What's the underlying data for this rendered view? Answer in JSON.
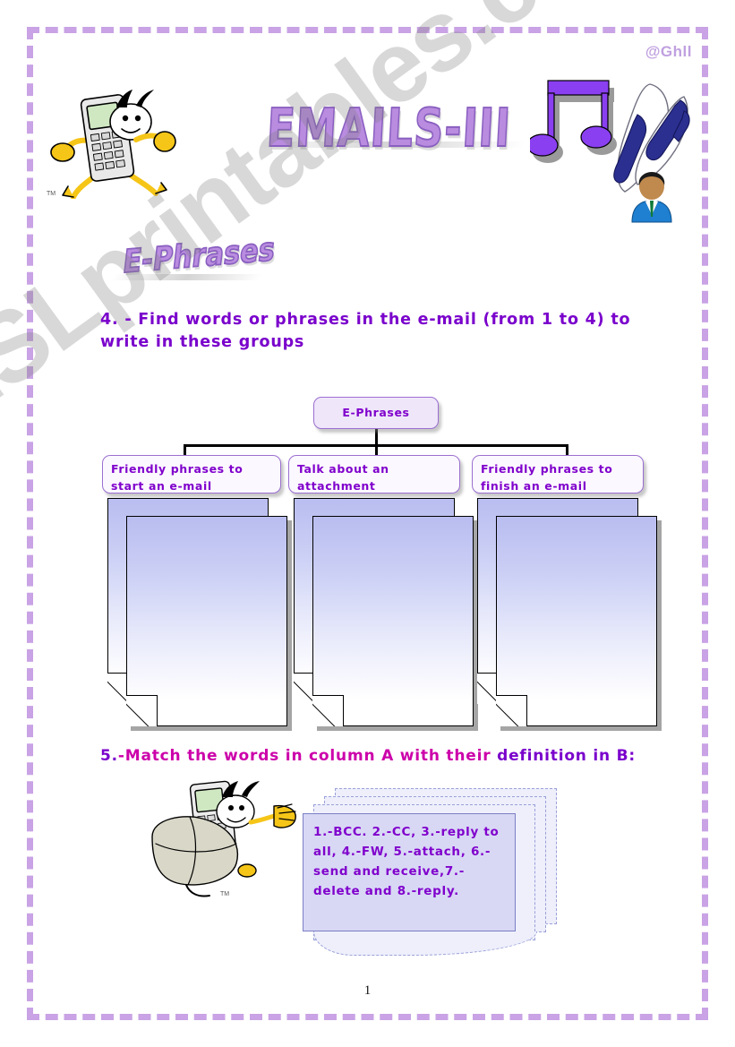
{
  "meta": {
    "credit": "@Ghll",
    "page_number": "1",
    "watermark": "ESLprintables.com"
  },
  "titles": {
    "main": "EMAILS-III",
    "section": "E-Phrases"
  },
  "exercises": [
    {
      "number": "4. - ",
      "text": "Find words or phrases in the e-mail (from 1 to 4) to write in these groups"
    },
    {
      "number": "5.",
      "text_magenta": "-Match the words in column A with their ",
      "text_purple": "definition in B:"
    }
  ],
  "diagram": {
    "root": "E-Phrases",
    "branches": [
      "Friendly phrases to start an e-mail",
      "Talk about an attachment",
      "Friendly phrases to finish an e-mail"
    ]
  },
  "answer_areas": [
    {
      "label": "blank-paper-stack-1"
    },
    {
      "label": "blank-paper-stack-2"
    },
    {
      "label": "blank-paper-stack-3"
    }
  ],
  "word_list": {
    "text": "1.-BCC. 2.-CC, 3.-reply to all, 4.-FW, 5.-attach, 6.- send and receive,7.- delete and  8.-reply."
  },
  "clipart": {
    "phone_mascot": "cellphone-mascot-icon",
    "music_notes": "music-notes-icon",
    "pens": "pens-icon",
    "person": "contact-person-icon",
    "mouse_mascot": "computer-mouse-mascot-icon"
  },
  "colors": {
    "accent_purple": "#8000cc",
    "magenta": "#cc00aa",
    "border_lilac": "#c9a3e5",
    "wordart_fill": "#b98ce0",
    "paper_top": "#b9bdf0",
    "card_fill": "#d8d8f5"
  }
}
